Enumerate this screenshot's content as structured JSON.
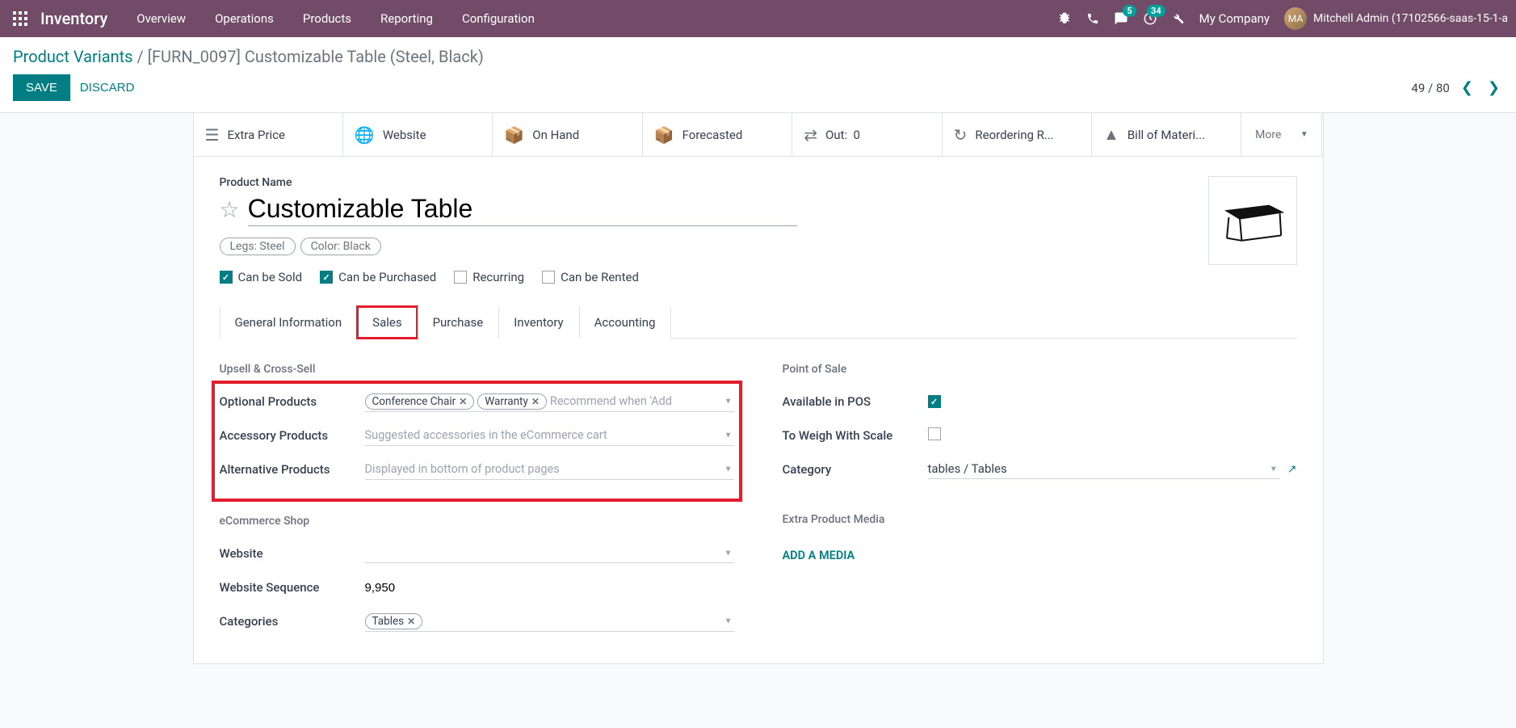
{
  "nav": {
    "brand": "Inventory",
    "menu": [
      "Overview",
      "Operations",
      "Products",
      "Reporting",
      "Configuration"
    ],
    "msg_badge": "5",
    "activity_badge": "34",
    "company": "My Company",
    "user": "Mitchell Admin (17102566-saas-15-1-a"
  },
  "breadcrumb": {
    "root": "Product Variants",
    "current": "[FURN_0097] Customizable Table (Steel, Black)"
  },
  "buttons": {
    "save": "SAVE",
    "discard": "DISCARD"
  },
  "pager": {
    "pos": "49",
    "total": "80"
  },
  "statbar": {
    "extra_price": "Extra Price",
    "website": "Website",
    "on_hand": "On Hand",
    "forecasted": "Forecasted",
    "out_label": "Out:",
    "out_val": "0",
    "reordering": "Reordering R...",
    "bom": "Bill of Materi...",
    "more": "More"
  },
  "form": {
    "name_label": "Product Name",
    "name": "Customizable Table",
    "variants": [
      "Legs: Steel",
      "Color: Black"
    ],
    "checks": {
      "sold": "Can be Sold",
      "purchased": "Can be Purchased",
      "recurring": "Recurring",
      "rented": "Can be Rented"
    },
    "tabs": [
      "General Information",
      "Sales",
      "Purchase",
      "Inventory",
      "Accounting"
    ]
  },
  "sales": {
    "upsell_title": "Upsell & Cross-Sell",
    "optional_label": "Optional Products",
    "optional_tags": [
      "Conference Chair",
      "Warranty"
    ],
    "optional_placeholder": "Recommend when 'Add",
    "accessory_label": "Accessory Products",
    "accessory_placeholder": "Suggested accessories in the eCommerce cart",
    "alternative_label": "Alternative Products",
    "alternative_placeholder": "Displayed in bottom of product pages",
    "pos_title": "Point of Sale",
    "available_pos": "Available in POS",
    "weigh": "To Weigh With Scale",
    "category_label": "Category",
    "category_val": "tables / Tables",
    "ecom_title": "eCommerce Shop",
    "website_label": "Website",
    "seq_label": "Website Sequence",
    "seq_val": "9,950",
    "cat_label": "Categories",
    "cat_tags": [
      "Tables"
    ],
    "media_title": "Extra Product Media",
    "add_media": "ADD A MEDIA"
  }
}
